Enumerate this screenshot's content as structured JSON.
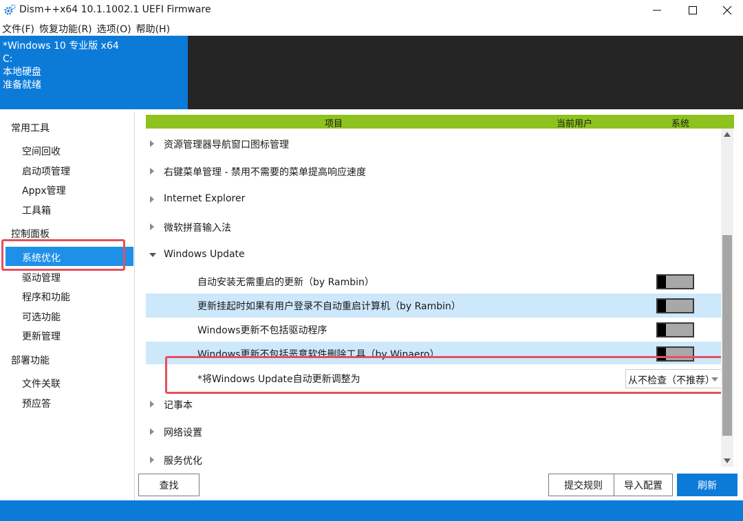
{
  "window": {
    "title": "Dism++x64 10.1.1002.1 UEFI Firmware",
    "icon": "gear-icon"
  },
  "menu": [
    "文件(F)",
    "恢复功能(R)",
    "选项(O)",
    "帮助(H)"
  ],
  "info": {
    "os": "*Windows 10 专业版 x64",
    "drive": "C:",
    "disk": "本地硬盘",
    "status": "准备就绪"
  },
  "sidebar": {
    "groups": [
      {
        "title": "常用工具",
        "items": [
          "空间回收",
          "启动项管理",
          "Appx管理",
          "工具箱"
        ]
      },
      {
        "title": "控制面板",
        "items": [
          "系统优化",
          "驱动管理",
          "程序和功能",
          "可选功能",
          "更新管理"
        ]
      },
      {
        "title": "部署功能",
        "items": [
          "文件关联",
          "预应答"
        ]
      }
    ],
    "selected": "系统优化"
  },
  "table": {
    "headers": {
      "item": "项目",
      "current_user": "当前用户",
      "system": "系统"
    },
    "rows": [
      "资源管理器导航窗口图标管理",
      "右键菜单管理 - 禁用不需要的菜单提高响应速度",
      "Internet Explorer",
      "微软拼音输入法",
      "Windows Update"
    ],
    "windows_update_children": [
      {
        "label": "自动安装无需重启的更新（by Rambin）",
        "toggle": "off"
      },
      {
        "label": "更新挂起时如果有用户登录不自动重启计算机（by Rambin）",
        "toggle": "off"
      },
      {
        "label": "Windows更新不包括驱动程序",
        "toggle": "off"
      },
      {
        "label": "Windows更新不包括恶意软件删除工具（by Winaero）",
        "toggle": "off"
      }
    ],
    "auto_update": {
      "label": "*将Windows Update自动更新调整为",
      "value": "从不检查（不推荐）"
    },
    "more_rows": [
      "记事本",
      "网络设置",
      "服务优化"
    ]
  },
  "buttons": {
    "find": "查找",
    "submit_rules": "提交规则",
    "import_config": "导入配置",
    "refresh": "刷新"
  },
  "colors": {
    "accent": "#0c7bd8",
    "header_green": "#8ec21e",
    "highlight_red": "#e4505c",
    "row_alt": "#cde8fb"
  }
}
